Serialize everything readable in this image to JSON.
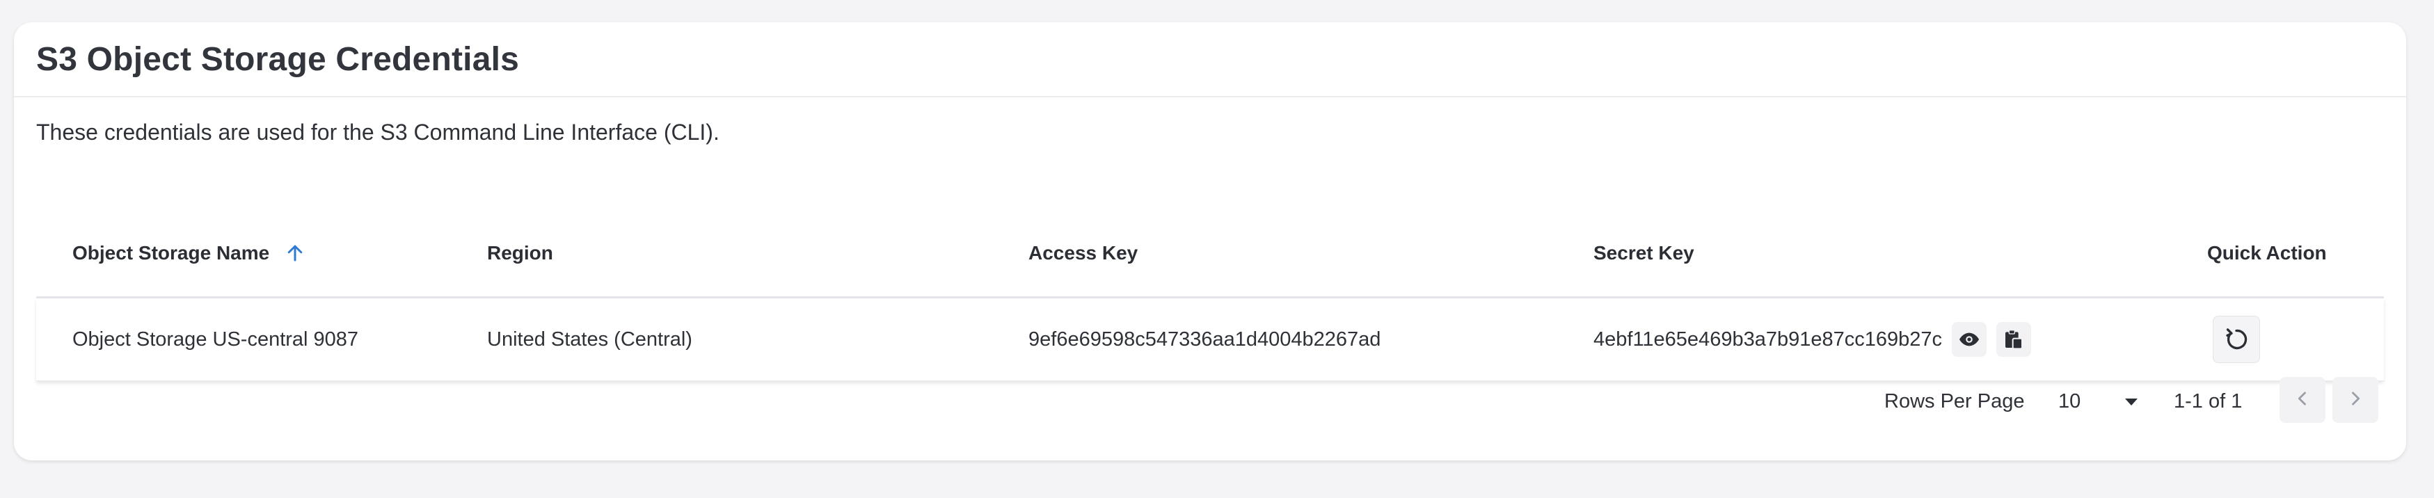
{
  "card": {
    "title": "S3 Object Storage Credentials",
    "description": "These credentials are used for the S3 Command Line Interface (CLI)."
  },
  "table": {
    "columns": [
      {
        "label": "Object Storage Name",
        "sorted": "ascending",
        "icon": "arrow-up-icon"
      },
      {
        "label": "Region"
      },
      {
        "label": "Access Key"
      },
      {
        "label": "Secret Key"
      },
      {
        "label": "Quick Action"
      }
    ],
    "rows": [
      {
        "name": "Object Storage US-central 9087",
        "region": "United States (Central)",
        "access_key": "9ef6e69598c547336aa1d4004b2267ad",
        "secret_key": "4ebf11e65e469b3a7b91e87cc169b27c",
        "secret_key_icons": [
          "eye-icon",
          "clipboard-icon"
        ],
        "quick_action_icon": "refresh-icon"
      }
    ]
  },
  "pagination": {
    "rows_per_page_label": "Rows Per Page",
    "rows_per_page_value": "10",
    "range_label": "1-1 of 1",
    "prev_icon": "chevron-left-icon",
    "next_icon": "chevron-right-icon"
  },
  "colors": {
    "sort_icon": "#2f7bd1",
    "page_background": "#f4f4f6",
    "card_background": "#ffffff",
    "text": "#2e3238"
  }
}
